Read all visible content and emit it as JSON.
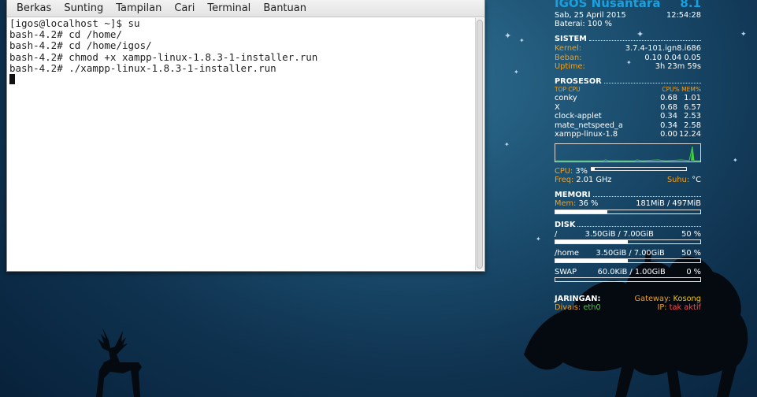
{
  "terminal": {
    "menu": [
      "Berkas",
      "Sunting",
      "Tampilan",
      "Cari",
      "Terminal",
      "Bantuan"
    ],
    "lines": [
      "[igos@localhost ~]$ su",
      "bash-4.2# cd /home/",
      "bash-4.2# cd /home/igos/",
      "bash-4.2# chmod +x xampp-linux-1.8.3-1-installer.run",
      "bash-4.2# ./xampp-linux-1.8.3-1-installer.run"
    ]
  },
  "conky": {
    "title": "IGOS Nusantara",
    "version": "8.1",
    "date": "Sab, 25 April 2015",
    "time": "12:54:28",
    "battery": "Baterai: 100 %",
    "sistem": {
      "heading": "SISTEM",
      "kernel_label": "Kernel:",
      "kernel": "3.7.4-101.ign8.i686",
      "load_label": "Beban:",
      "load": "0.10 0.04 0.05",
      "uptime_label": "Uptime:",
      "uptime": "3h 23m 59s"
    },
    "prosesor": {
      "heading": "PROSESOR",
      "top_label": "TOP CPU",
      "cols_label": "CPU% MEM%",
      "procs": [
        {
          "name": "conky",
          "cpu": "0.68",
          "mem": "1.01"
        },
        {
          "name": "X",
          "cpu": "0.68",
          "mem": "6.57"
        },
        {
          "name": "clock-applet",
          "cpu": "0.34",
          "mem": "2.53"
        },
        {
          "name": "mate_netspeed_a",
          "cpu": "0.34",
          "mem": "2.58"
        },
        {
          "name": "xampp-linux-1.8",
          "cpu": "0.00",
          "mem": "12.24"
        }
      ],
      "cpu_label": "CPU:",
      "cpu_value": "3%",
      "cpu_fraction": 0.03,
      "freq_label": "Freq:",
      "freq": "2.01 GHz",
      "temp_label": "Suhu:",
      "temp": "°C"
    },
    "memori": {
      "heading": "MEMORI",
      "mem_label": "Mem:",
      "mem_pct": "36 %",
      "mem_used": "181MiB / 497MiB",
      "fraction": 0.36
    },
    "disk": {
      "heading": "DISK",
      "items": [
        {
          "mount": "/",
          "usage": "3.50GiB / 7.00GiB",
          "pct": "50 %",
          "fraction": 0.5
        },
        {
          "mount": "/home",
          "usage": "3.50GiB / 7.00GiB",
          "pct": "50 %",
          "fraction": 0.5
        },
        {
          "mount": "SWAP",
          "usage": "60.0KiB / 1.00GiB",
          "pct": "0 %",
          "fraction": 0.0
        }
      ]
    },
    "jaringan": {
      "heading": "JARINGAN:",
      "gateway_label": "Gateway:",
      "gateway": "Kosong",
      "device_label": "Divais:",
      "device": "eth0",
      "ip_label": "IP:",
      "ip": "tak aktif"
    }
  },
  "colors": {
    "accent": "#1aa0de",
    "label_orange": "#f0a020",
    "label_yellow": "#f0c400",
    "ok_green": "#3fcf3f",
    "alert_red": "#ff4a4a"
  }
}
